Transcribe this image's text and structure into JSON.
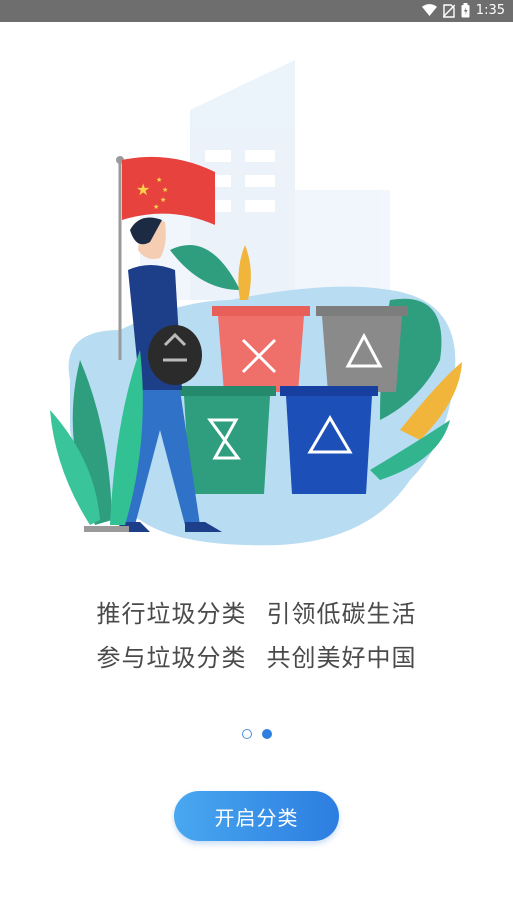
{
  "status_bar": {
    "time": "1:35",
    "icons": [
      "wifi-icon",
      "no-sim-icon",
      "battery-icon"
    ]
  },
  "illustration": {
    "bins": [
      {
        "name": "red-bin",
        "symbol": "hazard-icon",
        "color": "#ef6f6a"
      },
      {
        "name": "gray-bin",
        "symbol": "recycle-icon",
        "color": "#8a8a8a"
      },
      {
        "name": "green-bin",
        "symbol": "hourglass-icon",
        "color": "#2e9e7e"
      },
      {
        "name": "blue-bin",
        "symbol": "recycle-icon",
        "color": "#1c4fb8"
      }
    ]
  },
  "slogan": {
    "line1_a": "推行垃圾分类",
    "line1_b": "引领低碳生活",
    "line2_a": "参与垃圾分类",
    "line2_b": "共创美好中国"
  },
  "pager": {
    "total": 2,
    "current": 2
  },
  "start_button": {
    "label": "开启分类"
  },
  "colors": {
    "accent": "#2c7de0",
    "text": "#4a4a4a",
    "status_bar": "#6e6e6e"
  }
}
